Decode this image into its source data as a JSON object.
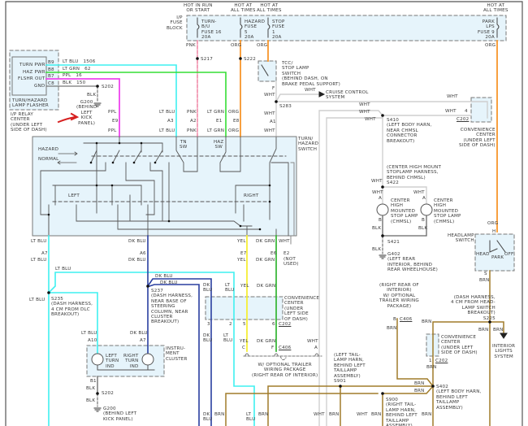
{
  "colors": {
    "lt_blu": "#3ff0f0",
    "lt_grn": "#35dd35",
    "ppl": "#ee44ee",
    "pnk": "#f08aa8",
    "org": "#f7962a",
    "yel": "#f5ef35",
    "dk_blu": "#2a3fa0",
    "dk_grn": "#3cb83c",
    "brn": "#a07c2a",
    "blk": "#666666",
    "wht": "#cfcfcf",
    "component_fill": "#e6f4fb"
  },
  "power": {
    "hot1": "HOT IN RUN\nOR START",
    "hot2": "HOT AT\nALL TIMES",
    "hot3": "HOT AT\nALL TIMES",
    "hot4": "HOT AT\nALL TIMES",
    "fuse_block": "I/P\nFUSE\nBLOCK",
    "fuse16": "TURN-\nB/U\nFUSE 16\n20A",
    "fuse5": "HAZARD\nFUSE\n5\n20A",
    "fuse1": "STOP\nFUSE\n1\n20A",
    "fuse9": "PARK\nLPS\nFUSE 9\n20A",
    "pnk": "PNK",
    "org1": "ORG",
    "org2": "ORG",
    "org3": "ORG",
    "s217": "S217",
    "s222": "S222"
  },
  "flasher": {
    "turn_pwr": "TURN PWR",
    "haz_pwr": "HAZ PWR",
    "flshr_out": "FLSHR OUT",
    "gnd": "GND",
    "b9": "B9",
    "b8": "B8",
    "b7": "B7",
    "c8": "C8",
    "w1": "LT BLU   1506",
    "w2": "LT GRN   62",
    "w3": "PPL   16",
    "w4": "BLK   150",
    "name": "TURN/HAZARD\nLAMP FLASHER",
    "relay_center": "I/P RELAY\nCENTER\n(UNDER LEFT\nSIDE OF DASH)",
    "s202": "S202",
    "blk": "BLK",
    "g200": "G200\n(BEHIND\nLEFT\nKICK\nPANEL)"
  },
  "switch_top": {
    "ppl1": "PPL",
    "e9": "E9",
    "ppl2": "PPL",
    "ltblu1": "LT BLU",
    "a3": "A3",
    "ltblu2": "LT BLU",
    "pnk1": "PNK",
    "a2": "A2",
    "pnk2": "PNK",
    "ltgrn1": "LT GRN",
    "e1": "E1",
    "ltgrn2": "LT GRN",
    "org1": "ORG",
    "e8": "E8",
    "org2": "ORG",
    "wht1": "WHT",
    "a1": "A1",
    "wht2": "WHT"
  },
  "stop": {
    "tcc": "TCC/\nSTOP LAMP\nSWITCH\n(BEHIND DASH, ON\nBRAKE PEDAL SUPPORT)",
    "f": "F",
    "wht1": "WHT",
    "wht2": "WHT",
    "cruise": "CRUISE CONTROL\nSYSTEM",
    "s283": "S283",
    "wht3": "WHT",
    "wht4": "WHT",
    "wht5": "WHT",
    "wht6": "WHT",
    "wht7": "WHT",
    "pin4": "4",
    "c202": "C202",
    "s410": "S410\n(LEFT BODY HARN,\nNEAR CHMSL\nCONNECTOR\nBREAKOUT)",
    "conv": "CONVENIENCE\nCENTER\n(UNDER LEFT\nSIDE OF DASH)"
  },
  "switch": {
    "hazard": "HAZARD",
    "normal": "NORMAL",
    "tn_sw": "TN\nSW",
    "haz_sw": "HAZ\nSW",
    "left": "LEFT",
    "right": "RIGHT",
    "name": "TURN/\nHAZARD\nSWITCH"
  },
  "switch_bottom": {
    "ltblu1": "LT BLU",
    "a7": "A7",
    "ltblu2": "LT BLU",
    "dkblu1": "DK BLU",
    "a6": "A6",
    "dkblu2": "DK BLU",
    "yel1": "YEL",
    "e7": "E7",
    "yel2": "YEL",
    "dkgrn1": "DK GRN",
    "e6": "E6",
    "dkgrn2": "DK GRN",
    "wht": "WHT",
    "e2": "E2",
    "not_used": "(NOT\nUSED)"
  },
  "cluster": {
    "ltblu1": "LT BLU",
    "dkblu1": "DK BLU",
    "dkblu2": "DK BLU",
    "ltblu2": "LT BLU",
    "s235": "S235\n(DASH HARNESS,\n4 CM FROM DLC\nBREAKOUT)",
    "s237": "S237\n(DASH HARNESS,\nNEAR BASE OF\nSTEERING\nCOLUMN, NEAR\nCLUSTER\nBREAKOUT)",
    "ltblu3": "LT BLU",
    "a10": "A10",
    "dkblu3": "DK BLU",
    "a7": "A7",
    "left_ind": "LEFT\nTURN\nIND",
    "right_ind": "RIGHT\nTURN\nIND",
    "name": "INSTRU-\nMENT\nCLUSTER",
    "b1": "B1",
    "blk1": "BLK",
    "s202": "S202",
    "blk2": "BLK",
    "g200": "G200\n(BEHIND LEFT\nKICK PANEL)"
  },
  "conv_mid": {
    "dkblu1": "DK\nBLU",
    "ltblu1": "LT\nBLU",
    "yel1": "YEL",
    "dkgrn1": "DK GRN",
    "name": "CONVENIENCE\nCENTER\n(UNDER\nLEFT SIDE\nOF DASH)",
    "p3": "3",
    "p2": "2",
    "p5": "5",
    "p6": "6",
    "c202": "C202",
    "dkblu2": "DK\nBLU",
    "ltblu2": "LT\nBLU",
    "yel2": "YEL",
    "dkgrn2": "DK GRN",
    "wht": "WHT",
    "c": "C",
    "f": "F",
    "c406": "C406",
    "a": "A",
    "trailer": "W/ OPTIONAL TRAILER\nWIRING PACKAGE\n(RIGHT REAR OF INTERIOR)"
  },
  "bottom": {
    "dkblu": "DK\nBLU",
    "brn1": "BRN",
    "ltblu": "LT\nBLU",
    "brn2": "BRN",
    "wht1": "WHT",
    "brn3": "BRN",
    "wht2": "WHT",
    "brn4": "BRN",
    "brn5": "BRN",
    "s901": "(LEFT TAIL-\nLAMP HARN,\nBEHIND LEFT\nTAILLAMP\nASSEMBLY)\nS901",
    "s900": "S900\n(RIGHT TAIL-\nLAMP HARN,\nBEHIND LEFT\nTAILLAMP\nASSEMBLY)",
    "s402": "S402\n(LEFT BODY HARN,\nBEHIND LEFT\nTAILLAMP\nASSEMBLY)",
    "brn6": "BRN",
    "brn7": "BRN"
  },
  "rear": {
    "right_rear": "(RIGHT REAR OF\nINTERIOR)\nW/ OPTIONAL\nTRAILER WIRING\nPACKAGE)",
    "b": "B",
    "c406": "C406",
    "brn1": "BRN",
    "brn2": "BRN",
    "conv": "CONVENIENCE\nCENTER\n(UNDER LEFT\nSIDE OF DASH)",
    "p1": "1",
    "c202": "C202",
    "brn3": "BRN",
    "s225": "(DASH HARNESS,\n4 CM FROM HEAD-\nLAMP SWITCH\nBREAKOUT)\nS225",
    "brn4": "BRN",
    "brn5": "BRN",
    "interior": "INTERIOR\nLIGHTS\nSYSTEM"
  },
  "headlamp": {
    "org": "ORG",
    "h": "H",
    "name": "HEADLAMP\nSWITCH",
    "head": "HEAD",
    "park": "PARK",
    "off": "OFF",
    "s": "S",
    "brn": "BRN"
  },
  "chmsl": {
    "s422": "(CENTER HIGH MOUNT\nSTOPLAMP HARNESS,\nBEHIND CHMSL)\nS422",
    "wht1": "WHT",
    "wht2": "WHT",
    "a1": "A",
    "wht3": "WHT",
    "a2": "A",
    "lamp1": "CENTER\nHIGH\nMOUNTED\nSTOP LAMP\n(CHMSL)",
    "lamp2": "CENTER\nHIGH\nMOUNTED\nSTOP LAMP\n(CHMSL)",
    "b1": "B",
    "b2": "B",
    "blk1": "BLK",
    "blk2": "BLK",
    "s421": "S421",
    "blk3": "BLK",
    "g402": "G402\n(LEFT REAR\nINTERIOR, BEHIND\nREAR WHEELHOUSE)"
  }
}
